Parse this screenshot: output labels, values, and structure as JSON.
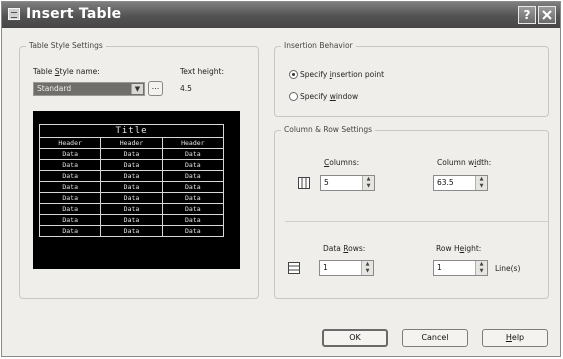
{
  "window": {
    "title": "Insert Table",
    "help_label": "?"
  },
  "table_style": {
    "legend": "Table Style Settings",
    "style_name_label": "Table Style name:",
    "style_name_value": "Standard",
    "browse_label": "...",
    "text_height_label": "Text height:",
    "text_height_value": "4.5"
  },
  "preview": {
    "title": "Title",
    "headers": [
      "Header",
      "Header",
      "Header"
    ],
    "rows": [
      [
        "Data",
        "Data",
        "Data"
      ],
      [
        "Data",
        "Data",
        "Data"
      ],
      [
        "Data",
        "Data",
        "Data"
      ],
      [
        "Data",
        "Data",
        "Data"
      ],
      [
        "Data",
        "Data",
        "Data"
      ],
      [
        "Data",
        "Data",
        "Data"
      ],
      [
        "Data",
        "Data",
        "Data"
      ],
      [
        "Data",
        "Data",
        "Data"
      ]
    ]
  },
  "insertion": {
    "legend": "Insertion Behavior",
    "options": [
      {
        "label": "Specify insertion point",
        "selected": true
      },
      {
        "label": "Specify window",
        "selected": false
      }
    ]
  },
  "col_row": {
    "legend": "Column & Row Settings",
    "columns_label": "Columns:",
    "columns_value": "5",
    "column_width_label": "Column width:",
    "column_width_value": "63.5",
    "data_rows_label": "Data Rows:",
    "data_rows_value": "1",
    "row_height_label": "Row Height:",
    "row_height_value": "1",
    "row_height_unit": "Line(s)"
  },
  "buttons": {
    "ok": "OK",
    "cancel": "Cancel",
    "help": "Help"
  }
}
